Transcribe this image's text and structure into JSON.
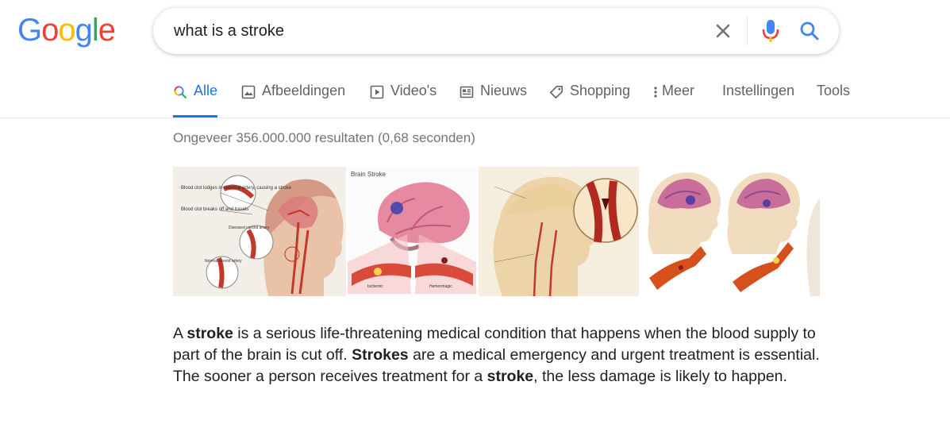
{
  "logo": {
    "letters": [
      {
        "ch": "G",
        "color": "#4285F4"
      },
      {
        "ch": "o",
        "color": "#EA4335"
      },
      {
        "ch": "o",
        "color": "#FBBC05"
      },
      {
        "ch": "g",
        "color": "#4285F4"
      },
      {
        "ch": "l",
        "color": "#34A853"
      },
      {
        "ch": "e",
        "color": "#EA4335"
      }
    ]
  },
  "search": {
    "query": "what is a stroke"
  },
  "tabs": [
    {
      "label": "Alle",
      "icon": "search-icon"
    },
    {
      "label": "Afbeeldingen",
      "icon": "image-icon"
    },
    {
      "label": "Video's",
      "icon": "play-icon"
    },
    {
      "label": "Nieuws",
      "icon": "news-icon"
    },
    {
      "label": "Shopping",
      "icon": "tag-icon"
    },
    {
      "label": "Meer",
      "icon": "more-vert-icon"
    },
    {
      "label": "Instellingen",
      "icon": ""
    },
    {
      "label": "Tools",
      "icon": ""
    }
  ],
  "results_stats": "Ongeveer 356.000.000 resultaten (0,68 seconden)",
  "images": {
    "labels": {
      "img1_a": "Blood clot lodges in cerebral artery, causing a stroke",
      "img1_b": "Blood clot breaks off and travels",
      "img1_c": "Diseased carotid artery",
      "img1_d": "Normal carotid artery",
      "img2_title": "Brain Stroke",
      "img2_a": "Ischemic",
      "img2_b": "Hemorrhagic"
    }
  },
  "snippet": {
    "parts": [
      {
        "text": "A ",
        "bold": false
      },
      {
        "text": "stroke",
        "bold": true
      },
      {
        "text": " is a serious life-threatening medical condition that happens when the blood supply to part of the brain is cut off. ",
        "bold": false
      },
      {
        "text": "Strokes",
        "bold": true
      },
      {
        "text": " are a medical emergency and urgent treatment is essential. The sooner a person receives treatment for a ",
        "bold": false
      },
      {
        "text": "stroke",
        "bold": true
      },
      {
        "text": ", the less damage is likely to happen.",
        "bold": false
      }
    ]
  },
  "colors": {
    "accent": "#1a73e8",
    "muted": "#5f6368",
    "stats": "#70757a"
  }
}
